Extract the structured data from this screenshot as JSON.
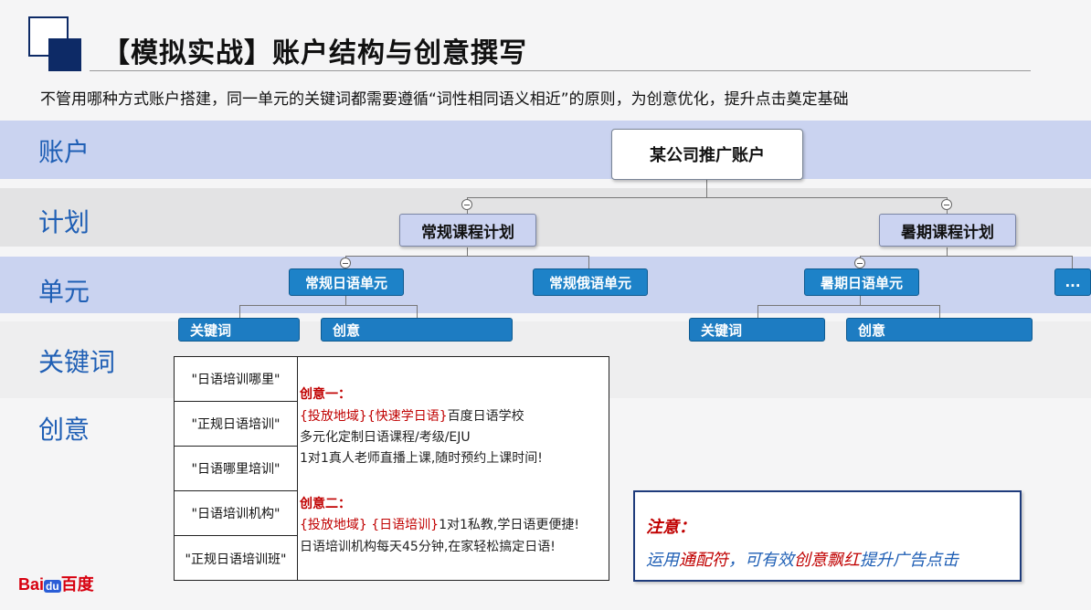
{
  "header": {
    "title": "【模拟实战】账户结构与创意撰写",
    "subtitle": "不管用哪种方式账户搭建，同一单元的关键词都需要遵循“词性相同语义相近”的原则，为创意优化，提升点击奠定基础"
  },
  "levels": [
    "账户",
    "计划",
    "单元",
    "关键词",
    "创意"
  ],
  "tree": {
    "account": "某公司推广账户",
    "plans": [
      "常规课程计划",
      "暑期课程计划"
    ],
    "units": [
      "常规日语单元",
      "常规俄语单元",
      "暑期日语单元",
      "..."
    ],
    "leaves": [
      "关键词",
      "创意",
      "关键词",
      "创意"
    ]
  },
  "keywords": [
    "\"日语培训哪里\"",
    "\"正规日语培训\"",
    "\"日语哪里培训\"",
    "\"日语培训机构\"",
    "\"正规日语培训班\""
  ],
  "creatives": {
    "c1_title": "创意一：",
    "c1_l1_w1": "{投放地域}",
    "c1_l1_w2": "{快速学日语}",
    "c1_l1_rest": "百度日语学校",
    "c1_l2": "多元化定制日语课程/考级/EJU",
    "c1_l3": "1对1真人老师直播上课,随时预约上课时间!",
    "c2_title": "创意二：",
    "c2_l1_w1": "{投放地域}",
    "c2_l1_w2": " {日语培训}",
    "c2_l1_rest": "1对1私教,学日语更便捷!",
    "c2_l2": "日语培训机构每天45分钟,在家轻松搞定日语!"
  },
  "note": {
    "title": "注意：",
    "p1": "运用",
    "p2": "通配符",
    "p3": "，可有效",
    "p4": "创意飘红",
    "p5": "提升广告点击"
  },
  "logo": {
    "bai": "Bai",
    "du": "du",
    "cn": "百度"
  }
}
